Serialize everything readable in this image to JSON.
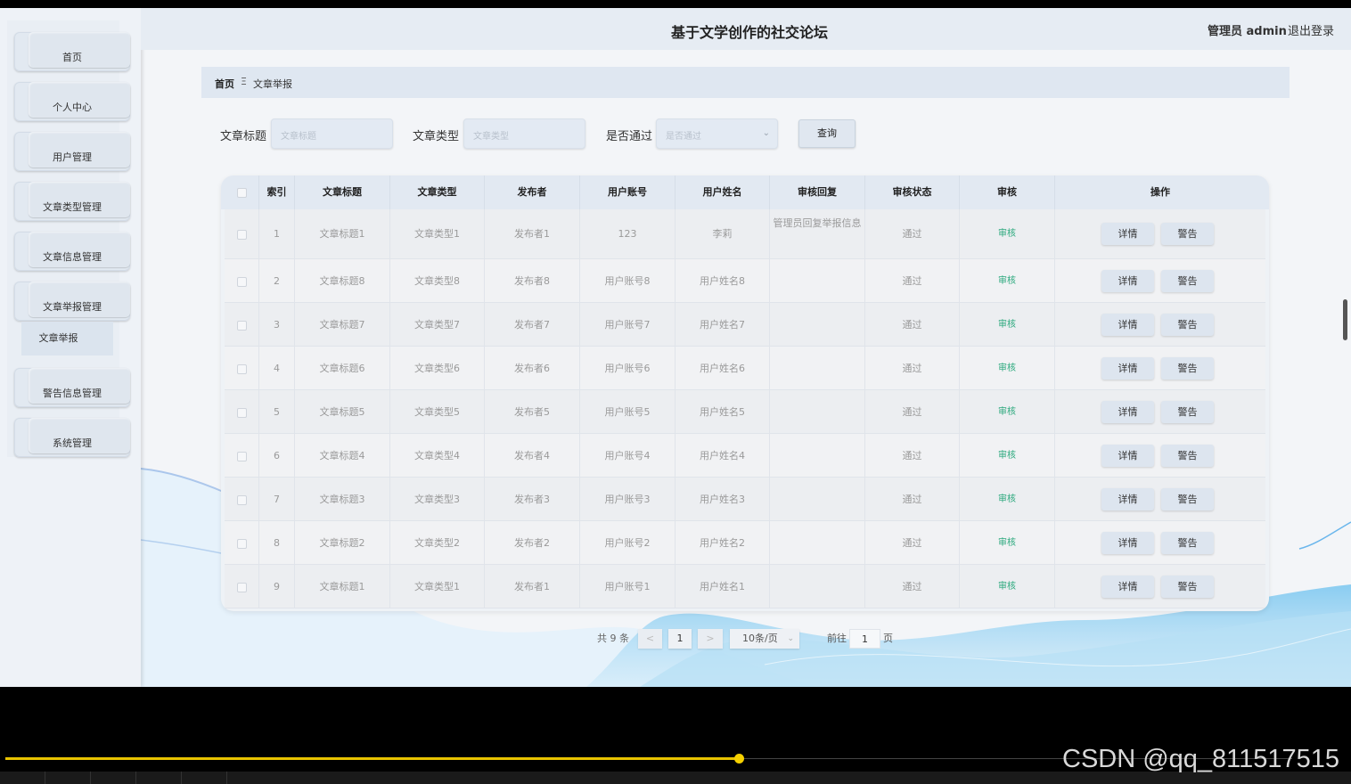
{
  "header": {
    "title": "基于文学创作的社交论坛",
    "admin": "管理员 admin",
    "logout": "退出登录"
  },
  "sidebar": {
    "items": [
      {
        "label": "首页"
      },
      {
        "label": "个人中心"
      },
      {
        "label": "用户管理"
      },
      {
        "label": "文章类型管理"
      },
      {
        "label": "文章信息管理"
      },
      {
        "label": "文章举报管理"
      },
      {
        "label": "警告信息管理"
      },
      {
        "label": "系统管理"
      }
    ],
    "active_sub": "文章举报"
  },
  "breadcrumb": {
    "home": "首页",
    "sep": "Ξ",
    "current": "文章举报"
  },
  "search": {
    "title_label": "文章标题",
    "title_placeholder": "文章标题",
    "type_label": "文章类型",
    "type_placeholder": "文章类型",
    "pass_label": "是否通过",
    "pass_placeholder": "是否通过",
    "button": "查询"
  },
  "table": {
    "headers": [
      "索引",
      "文章标题",
      "文章类型",
      "发布者",
      "用户账号",
      "用户姓名",
      "审核回复",
      "审核状态",
      "审核",
      "操作"
    ],
    "rows": [
      {
        "idx": "1",
        "title": "文章标题1",
        "type": "文章类型1",
        "publisher": "发布者1",
        "account": "123",
        "name": "李莉",
        "reply": "管理员回复举报信息",
        "status": "通过",
        "audit": "审核"
      },
      {
        "idx": "2",
        "title": "文章标题8",
        "type": "文章类型8",
        "publisher": "发布者8",
        "account": "用户账号8",
        "name": "用户姓名8",
        "reply": "",
        "status": "通过",
        "audit": "审核"
      },
      {
        "idx": "3",
        "title": "文章标题7",
        "type": "文章类型7",
        "publisher": "发布者7",
        "account": "用户账号7",
        "name": "用户姓名7",
        "reply": "",
        "status": "通过",
        "audit": "审核"
      },
      {
        "idx": "4",
        "title": "文章标题6",
        "type": "文章类型6",
        "publisher": "发布者6",
        "account": "用户账号6",
        "name": "用户姓名6",
        "reply": "",
        "status": "通过",
        "audit": "审核"
      },
      {
        "idx": "5",
        "title": "文章标题5",
        "type": "文章类型5",
        "publisher": "发布者5",
        "account": "用户账号5",
        "name": "用户姓名5",
        "reply": "",
        "status": "通过",
        "audit": "审核"
      },
      {
        "idx": "6",
        "title": "文章标题4",
        "type": "文章类型4",
        "publisher": "发布者4",
        "account": "用户账号4",
        "name": "用户姓名4",
        "reply": "",
        "status": "通过",
        "audit": "审核"
      },
      {
        "idx": "7",
        "title": "文章标题3",
        "type": "文章类型3",
        "publisher": "发布者3",
        "account": "用户账号3",
        "name": "用户姓名3",
        "reply": "",
        "status": "通过",
        "audit": "审核"
      },
      {
        "idx": "8",
        "title": "文章标题2",
        "type": "文章类型2",
        "publisher": "发布者2",
        "account": "用户账号2",
        "name": "用户姓名2",
        "reply": "",
        "status": "通过",
        "audit": "审核"
      },
      {
        "idx": "9",
        "title": "文章标题1",
        "type": "文章类型1",
        "publisher": "发布者1",
        "account": "用户账号1",
        "name": "用户姓名1",
        "reply": "",
        "status": "通过",
        "audit": "审核"
      }
    ],
    "detail_label": "详情",
    "warn_label": "警告"
  },
  "pagination": {
    "total": "共 9 条",
    "prev": "<",
    "page": "1",
    "next": ">",
    "page_size": "10条/页",
    "goto_label": "前往",
    "goto_value": "1",
    "page_suffix": "页"
  },
  "video": {
    "progress": 0.57,
    "watermark": "CSDN @qq_811517515"
  }
}
